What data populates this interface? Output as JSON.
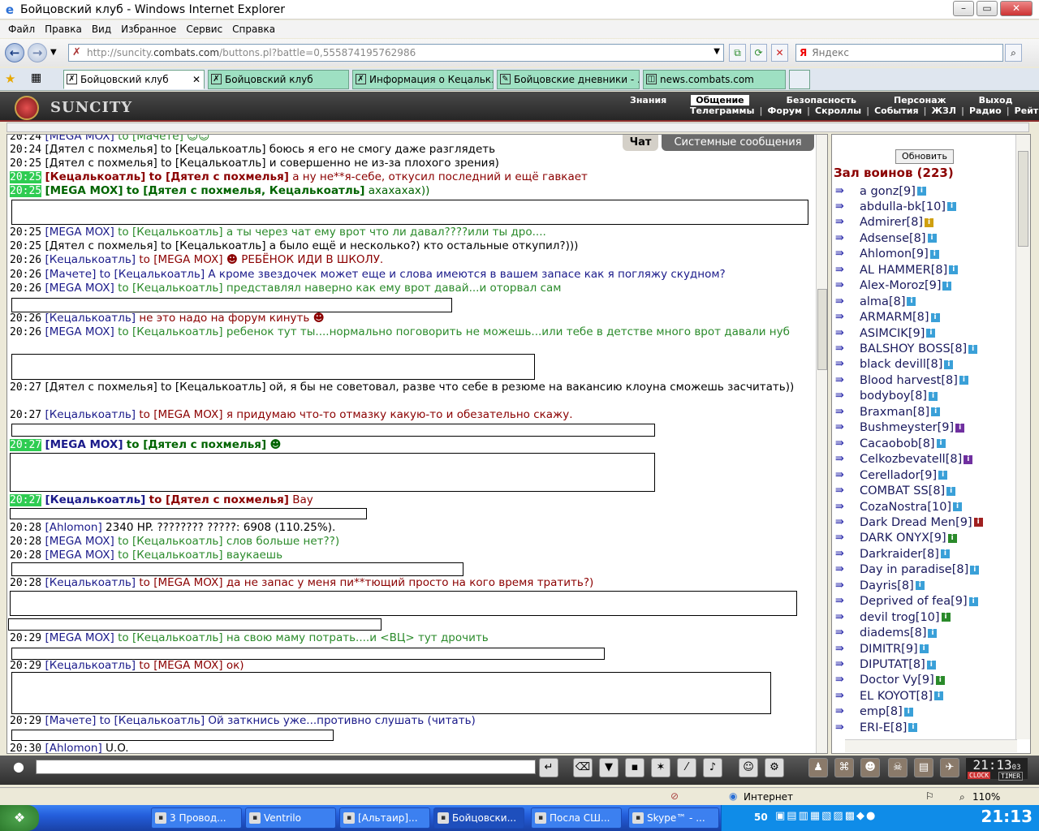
{
  "window": {
    "title": "Бойцовский клуб - Windows Internet Explorer",
    "min": "–",
    "max": "▭",
    "close": "✕"
  },
  "menu": [
    "Файл",
    "Правка",
    "Вид",
    "Избранное",
    "Сервис",
    "Справка"
  ],
  "nav": {
    "url_prefix": "http://suncity.",
    "url_domain": "combats.com",
    "url_suffix": "/buttons.pl?battle=0,555874195762986",
    "search_placeholder": "Яндекс",
    "search_logo": "Я"
  },
  "tabs": [
    {
      "label": "Бойцовский клуб",
      "close": "✕"
    },
    {
      "label": "Бойцовский клуб"
    },
    {
      "label": "Информация о Кецальк..."
    },
    {
      "label": "Бойцовские дневники - ..."
    },
    {
      "label": "news.combats.com"
    }
  ],
  "game": {
    "logo": "SUNCITY",
    "menu_top": [
      "Знания",
      "Общение",
      "Безопасность",
      "Персонаж",
      "Выход"
    ],
    "menu_bottom": [
      "Телеграммы",
      "Форум",
      "Скроллы",
      "События",
      "ЖЗЛ",
      "Радио",
      "Рейтинг"
    ]
  },
  "chat": {
    "tab_chat": "Чат",
    "tab_system": "Системные сообщения",
    "messages": [
      {
        "time": "20:24",
        "nick": "[MEGA MOX]",
        "to": "to [Мачете]",
        "text": "☺☺"
      },
      {
        "time": "20:24",
        "nick": "[Дятел с похмелья]",
        "to": "to [Кецалькоатль]",
        "text": "боюсь я его не смогу даже разглядеть"
      },
      {
        "time": "20:25",
        "nick": "[Дятел с похмелья]",
        "to": "to [Кецалькоатль]",
        "text": "и совершенно не из-за плохого зрения)"
      },
      {
        "time": "20:25",
        "nick": "[Кецалькоатль]",
        "to": "to [Дятел с похмелья]",
        "text": "а ну не**я-себе, откусил последний и ещё гавкает"
      },
      {
        "time": "20:25",
        "nick": "[MEGA MOX]",
        "to": "to [Дятел с похмелья, Кецалькоатль]",
        "text": "ахахахах))"
      },
      {
        "time": "20:25",
        "nick": "[MEGA MOX]",
        "to": "to [Кецалькоатль]",
        "text": "а ты через чат ему врот что ли давал????или ты дро...."
      },
      {
        "time": "20:25",
        "nick": "[Дятел с похмелья]",
        "to": "to [Кецалькоатль]",
        "text": "а было ещё и несколько?) кто остальные откупил?)))"
      },
      {
        "time": "20:26",
        "nick": "[Кецалькоатль]",
        "to": "to [MEGA MOX]",
        "text": "☻ РЕБЁНОК ИДИ В ШКОЛУ."
      },
      {
        "time": "20:26",
        "nick": "[Мачете]",
        "to": "to [Кецалькоатль]",
        "text": "А кроме звездочек может еще и слова имеются в вашем запасе как я погляжу скудном?"
      },
      {
        "time": "20:26",
        "nick": "[MEGA MOX]",
        "to": "to [Кецалькоатль]",
        "text": "представлял наверно как ему врот давай...и оторвал сам"
      },
      {
        "time": "20:26",
        "nick": "[Кецалькоатль]",
        "to": "",
        "text": "не это надо на форум кинуть ☻"
      },
      {
        "time": "20:26",
        "nick": "[MEGA MOX]",
        "to": "to [Кецалькоатль]",
        "text": "ребенок тут ты....нормально поговорить не можешь...или тебе в детстве много врот давали нуб"
      },
      {
        "time": "20:27",
        "nick": "[Дятел с похмелья]",
        "to": "to [Кецалькоатль]",
        "text": "ой, я бы не советовал, разве что себе в резюме на вакансию клоуна сможешь засчитать))"
      },
      {
        "time": "20:27",
        "nick": "[Кецалькоатль]",
        "to": "to [MEGA MOX]",
        "text": "я придумаю что-то отмазку какую-то и обезательно скажу."
      },
      {
        "time": "20:27",
        "nick": "[MEGA MOX]",
        "to": "to [Дятел с похмелья]",
        "text": "☻"
      },
      {
        "time": "20:27",
        "nick": "[Кецалькоатль]",
        "to": "to [Дятел с похмелья]",
        "text": "Вау"
      },
      {
        "time": "20:28",
        "nick": "[Ahlomon]",
        "to": "",
        "text": "2340 HP. ???????? ?????: 6908 (110.25%)."
      },
      {
        "time": "20:28",
        "nick": "[MEGA MOX]",
        "to": "to [Кецалькоатль]",
        "text": "слов больше нет??)"
      },
      {
        "time": "20:28",
        "nick": "[MEGA MOX]",
        "to": "to [Кецалькоатль]",
        "text": "ваукаешь"
      },
      {
        "time": "20:28",
        "nick": "[Кецалькоатль]",
        "to": "to [MEGA MOX]",
        "text": "да не запас у меня пи**тющий просто на кого время тратить?)"
      },
      {
        "time": "20:29",
        "nick": "[MEGA MOX]",
        "to": "to [Кецалькоатль]",
        "text": "на свою маму потрать....и <ВЦ> тут дрочить"
      },
      {
        "time": "20:29",
        "nick": "[Кецалькоатль]",
        "to": "to [MEGA MOX]",
        "text": "ок)"
      },
      {
        "time": "20:29",
        "nick": "[Мачете]",
        "to": "to [Кецалькоатль]",
        "text": "Ой заткнись уже...противно слушать (читать)"
      },
      {
        "time": "20:30",
        "nick": "[Ahlomon]",
        "to": "",
        "text": "U.O."
      }
    ]
  },
  "side": {
    "refresh": "Обновить",
    "hall": "Зал воинов (223)",
    "players": [
      {
        "name": "a gonz",
        "lvl": "[9]"
      },
      {
        "name": "abdulla-bk",
        "lvl": "[10]"
      },
      {
        "name": "Admirer",
        "lvl": "[8]"
      },
      {
        "name": "Adsense",
        "lvl": "[8]"
      },
      {
        "name": "Ahlomon",
        "lvl": "[9]"
      },
      {
        "name": "AL HAMMER",
        "lvl": "[8]"
      },
      {
        "name": "Alex-Moroz",
        "lvl": "[9]"
      },
      {
        "name": "alma",
        "lvl": "[8]"
      },
      {
        "name": "ARMARM",
        "lvl": "[8]"
      },
      {
        "name": "ASIMCIK",
        "lvl": "[9]"
      },
      {
        "name": "BALSHOY BOSS",
        "lvl": "[8]"
      },
      {
        "name": "black devill",
        "lvl": "[8]"
      },
      {
        "name": "Blood harvest",
        "lvl": "[8]"
      },
      {
        "name": "bodyboy",
        "lvl": "[8]"
      },
      {
        "name": "Braxman",
        "lvl": "[8]"
      },
      {
        "name": "Bushmeyster",
        "lvl": "[9]"
      },
      {
        "name": "Cacaobob",
        "lvl": "[8]"
      },
      {
        "name": "Celkozbevatell",
        "lvl": "[8]"
      },
      {
        "name": "Cerellador",
        "lvl": "[9]"
      },
      {
        "name": "COMBAT SS",
        "lvl": "[8]"
      },
      {
        "name": "CozaNostra",
        "lvl": "[10]"
      },
      {
        "name": "Dark Dread Men",
        "lvl": "[9]"
      },
      {
        "name": "DARK ONYX",
        "lvl": "[9]"
      },
      {
        "name": "Darkraider",
        "lvl": "[8]"
      },
      {
        "name": "Day in paradise",
        "lvl": "[8]"
      },
      {
        "name": "Dayris",
        "lvl": "[8]"
      },
      {
        "name": "Deprived of fea",
        "lvl": "[9]"
      },
      {
        "name": "devil trog",
        "lvl": "[10]"
      },
      {
        "name": "diadems",
        "lvl": "[8]"
      },
      {
        "name": "DIMITR",
        "lvl": "[9]"
      },
      {
        "name": "DIPUTAT",
        "lvl": "[8]"
      },
      {
        "name": "Doctor Vy",
        "lvl": "[9]"
      },
      {
        "name": "EL KOYOT",
        "lvl": "[8]"
      },
      {
        "name": "emp",
        "lvl": "[8]"
      },
      {
        "name": "ERI-E",
        "lvl": "[8]"
      }
    ]
  },
  "bottom": {
    "clock": "21:13",
    "seconds": "03",
    "clock_label": "CLOCK",
    "timer_label": "TIMER"
  },
  "status": {
    "zone": "Интернет",
    "zoom": "110%"
  },
  "taskbar": {
    "items": [
      {
        "label": "3 Провод..."
      },
      {
        "label": "Ventrilo"
      },
      {
        "label": "[Альтаир]..."
      },
      {
        "label": "Бойцовски..."
      },
      {
        "label": "Посла СШ..."
      },
      {
        "label": "Skype™ - ..."
      }
    ],
    "time": "21:13",
    "tray_nums": "50"
  }
}
